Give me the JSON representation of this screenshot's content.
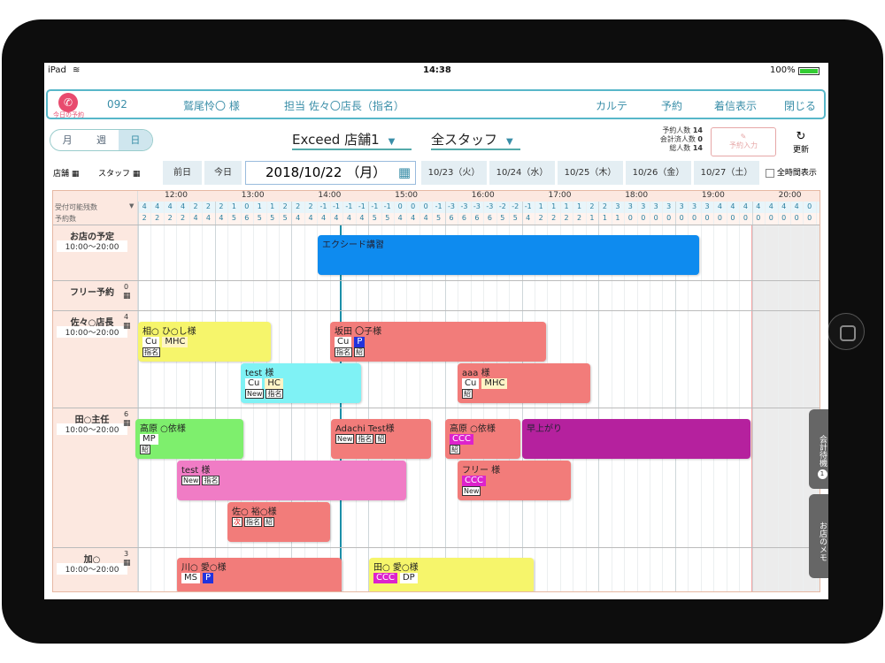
{
  "status": {
    "device": "iPad",
    "wifi": "wifi-icon",
    "time": "14:38",
    "battery": "100%"
  },
  "header": {
    "today_label": "今日の予約",
    "number": "092",
    "customer": "鷲尾怜〇 様",
    "staff": "担当 佐々〇店長（指名）",
    "karte": "カルテ",
    "reserve": "予約",
    "incoming": "着信表示",
    "close": "閉じる"
  },
  "view_tabs": [
    "月",
    "週",
    "日"
  ],
  "store_select": "Exceed 店舗1",
  "staff_select": "全スタッフ",
  "counts": {
    "reservations_label": "予約人数",
    "reservations": "14",
    "checked_label": "会計済人数",
    "checked": "0",
    "total_label": "総人数",
    "total": "14"
  },
  "reserve_input": "予約入力",
  "refresh": "更新",
  "toolbar": {
    "store": "店舗",
    "staff": "スタッフ",
    "prev": "前日",
    "today": "今日",
    "current_date": "2018/10/22 （月）",
    "dates": [
      "10/23（火）",
      "10/24（水）",
      "10/25（木）",
      "10/26（金）",
      "10/27（土）"
    ],
    "all_time": "全時間表示"
  },
  "schedule": {
    "hours": [
      "12:00",
      "13:00",
      "14:00",
      "15:00",
      "16:00",
      "17:00",
      "18:00",
      "19:00",
      "20:00"
    ],
    "row_labels": [
      "受付可能残数",
      "予約数"
    ],
    "available": [
      "4",
      "4",
      "4",
      "4",
      "2",
      "2",
      "2",
      "1",
      "0",
      "1",
      "1",
      "2",
      "2",
      "2",
      "-1",
      "-1",
      "-1",
      "-1",
      "-1",
      "-1",
      "0",
      "0",
      "0",
      "-1",
      "-3",
      "-3",
      "-3",
      "-3",
      "-2",
      "-2",
      "-1",
      "1",
      "1",
      "1",
      "1",
      "2",
      "2",
      "3",
      "3",
      "3",
      "3",
      "3",
      "3",
      "3",
      "3",
      "4",
      "4",
      "4",
      "4",
      "4",
      "4",
      "4",
      "0",
      "0",
      "0",
      "0",
      "0",
      "0",
      "0"
    ],
    "booked": [
      "2",
      "2",
      "2",
      "2",
      "4",
      "4",
      "4",
      "5",
      "6",
      "5",
      "5",
      "5",
      "4",
      "4",
      "4",
      "4",
      "4",
      "4",
      "5",
      "5",
      "4",
      "4",
      "4",
      "5",
      "6",
      "6",
      "6",
      "6",
      "5",
      "5",
      "4",
      "2",
      "2",
      "2",
      "2",
      "1",
      "1",
      "1",
      "0",
      "0",
      "0",
      "0",
      "0",
      "0",
      "0",
      "0",
      "0",
      "0",
      "0",
      "0",
      "0",
      "0",
      "0",
      "0",
      "0",
      "0",
      "0",
      "0",
      "0"
    ],
    "staff": [
      {
        "name": "お店の予定",
        "hours": "10:00〜20:00",
        "count": ""
      },
      {
        "name": "フリー予約",
        "hours": "",
        "count": "0"
      },
      {
        "name": "佐々○店長",
        "hours": "10:00〜20:00",
        "count": "4"
      },
      {
        "name": "田○主任",
        "hours": "10:00〜20:00",
        "count": "6"
      },
      {
        "name": "加○",
        "hours": "10:00〜20:00",
        "count": "3"
      }
    ],
    "events": [
      {
        "title": "エクシード講習",
        "chips": [],
        "tags": []
      },
      {
        "title": "相○ ひ○し様",
        "chips": [
          "Cu",
          "MHC"
        ],
        "tags": [
          "指名"
        ]
      },
      {
        "title": "坂田 〇子様",
        "chips": [
          "Cu",
          "P"
        ],
        "tags": [
          "指名",
          "紹"
        ]
      },
      {
        "title": "test 様",
        "chips": [
          "Cu",
          "HC"
        ],
        "tags": [
          "New",
          "指名"
        ]
      },
      {
        "title": "aaa 様",
        "chips": [
          "Cu",
          "MHC"
        ],
        "tags": [
          "紹"
        ]
      },
      {
        "title": "高原 ○依様",
        "chips": [
          "MP"
        ],
        "tags": [
          "紹"
        ]
      },
      {
        "title": "Adachi Test様",
        "chips": [],
        "tags": [
          "New",
          "指名",
          "紹"
        ]
      },
      {
        "title": "高原 ○依様",
        "chips": [
          "CCC"
        ],
        "tags": [
          "紹"
        ]
      },
      {
        "title": "早上がり",
        "chips": [],
        "tags": []
      },
      {
        "title": "test 様",
        "chips": [],
        "tags": [
          "New",
          "指名"
        ]
      },
      {
        "title": "フリー 様",
        "chips": [
          "CCC"
        ],
        "tags": [
          "New"
        ]
      },
      {
        "title": "佐○ 裕○様",
        "chips": [],
        "tags": [
          "次",
          "指名",
          "紹"
        ]
      },
      {
        "title": "川○ 愛○様",
        "chips": [
          "MS",
          "P"
        ],
        "tags": []
      },
      {
        "title": "田○ 愛○様",
        "chips": [
          "CCC",
          "DP"
        ],
        "tags": []
      }
    ]
  },
  "side_tabs": {
    "accounting": "会計待機",
    "badge": "1",
    "memo": "お店のメモ"
  },
  "colors": {
    "accent": "#3a8ea8",
    "blue": "#0e8bef",
    "yellow": "#f6f56b",
    "salmon": "#f27c7a",
    "cyan": "#7ff2f5",
    "green": "#7eef6d",
    "magenta": "#b5219e",
    "pink": "#f07cc5"
  }
}
